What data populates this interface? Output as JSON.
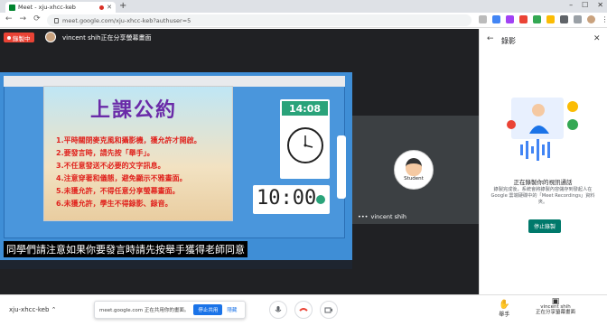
{
  "browser": {
    "tab_title": "Meet - xju-xhcc-keb",
    "url": "meet.google.com/xju-xhcc-keb?authuser=5"
  },
  "meet": {
    "recording_badge": "錄製中",
    "presenter_text": "vincent shih正在分享螢幕畫面"
  },
  "slide": {
    "title": "上課公約",
    "rules": [
      "1.平時關閉麥克風和攝影機，獲允許才開啟。",
      "2.要發言時，請先按「舉手」。",
      "3.不任意發送不必要的文字訊息。",
      "4.注意穿著和儀態，避免顯示不雅畫面。",
      "5.未獲允許，不得任意分享螢幕畫面。",
      "6.未獲允許，學生不得錄影、錄音。"
    ]
  },
  "clock": {
    "digital": "14:08",
    "timer": "10:00"
  },
  "caption": "同學們請注意如果你要發言時請先按舉手獲得老師同意",
  "participant": {
    "avatar_label": "Student",
    "name": "vincent shih"
  },
  "bottom": {
    "meeting_code": "xju-xhcc-keb",
    "share_notice": "meet.google.com 正在共用你的畫面。",
    "stop_share": "停止共用",
    "hide": "隱藏",
    "raise_hand": "舉手",
    "presenting_name": "vincent shih",
    "presenting_label": "正在分享螢幕畫面"
  },
  "panel": {
    "title": "錄影",
    "heading": "正在錄製你的視訊通話",
    "body": "錄製完成後，系統會將錄製內容儲存到發起人在 Google 雲端硬碟中的「Meet Recordings」資料夾。",
    "stop_button": "停止錄製"
  },
  "colors": {
    "record_red": "#ea4335",
    "meet_dark": "#202124",
    "accent_teal": "#00796b",
    "link_blue": "#1a73e8"
  }
}
